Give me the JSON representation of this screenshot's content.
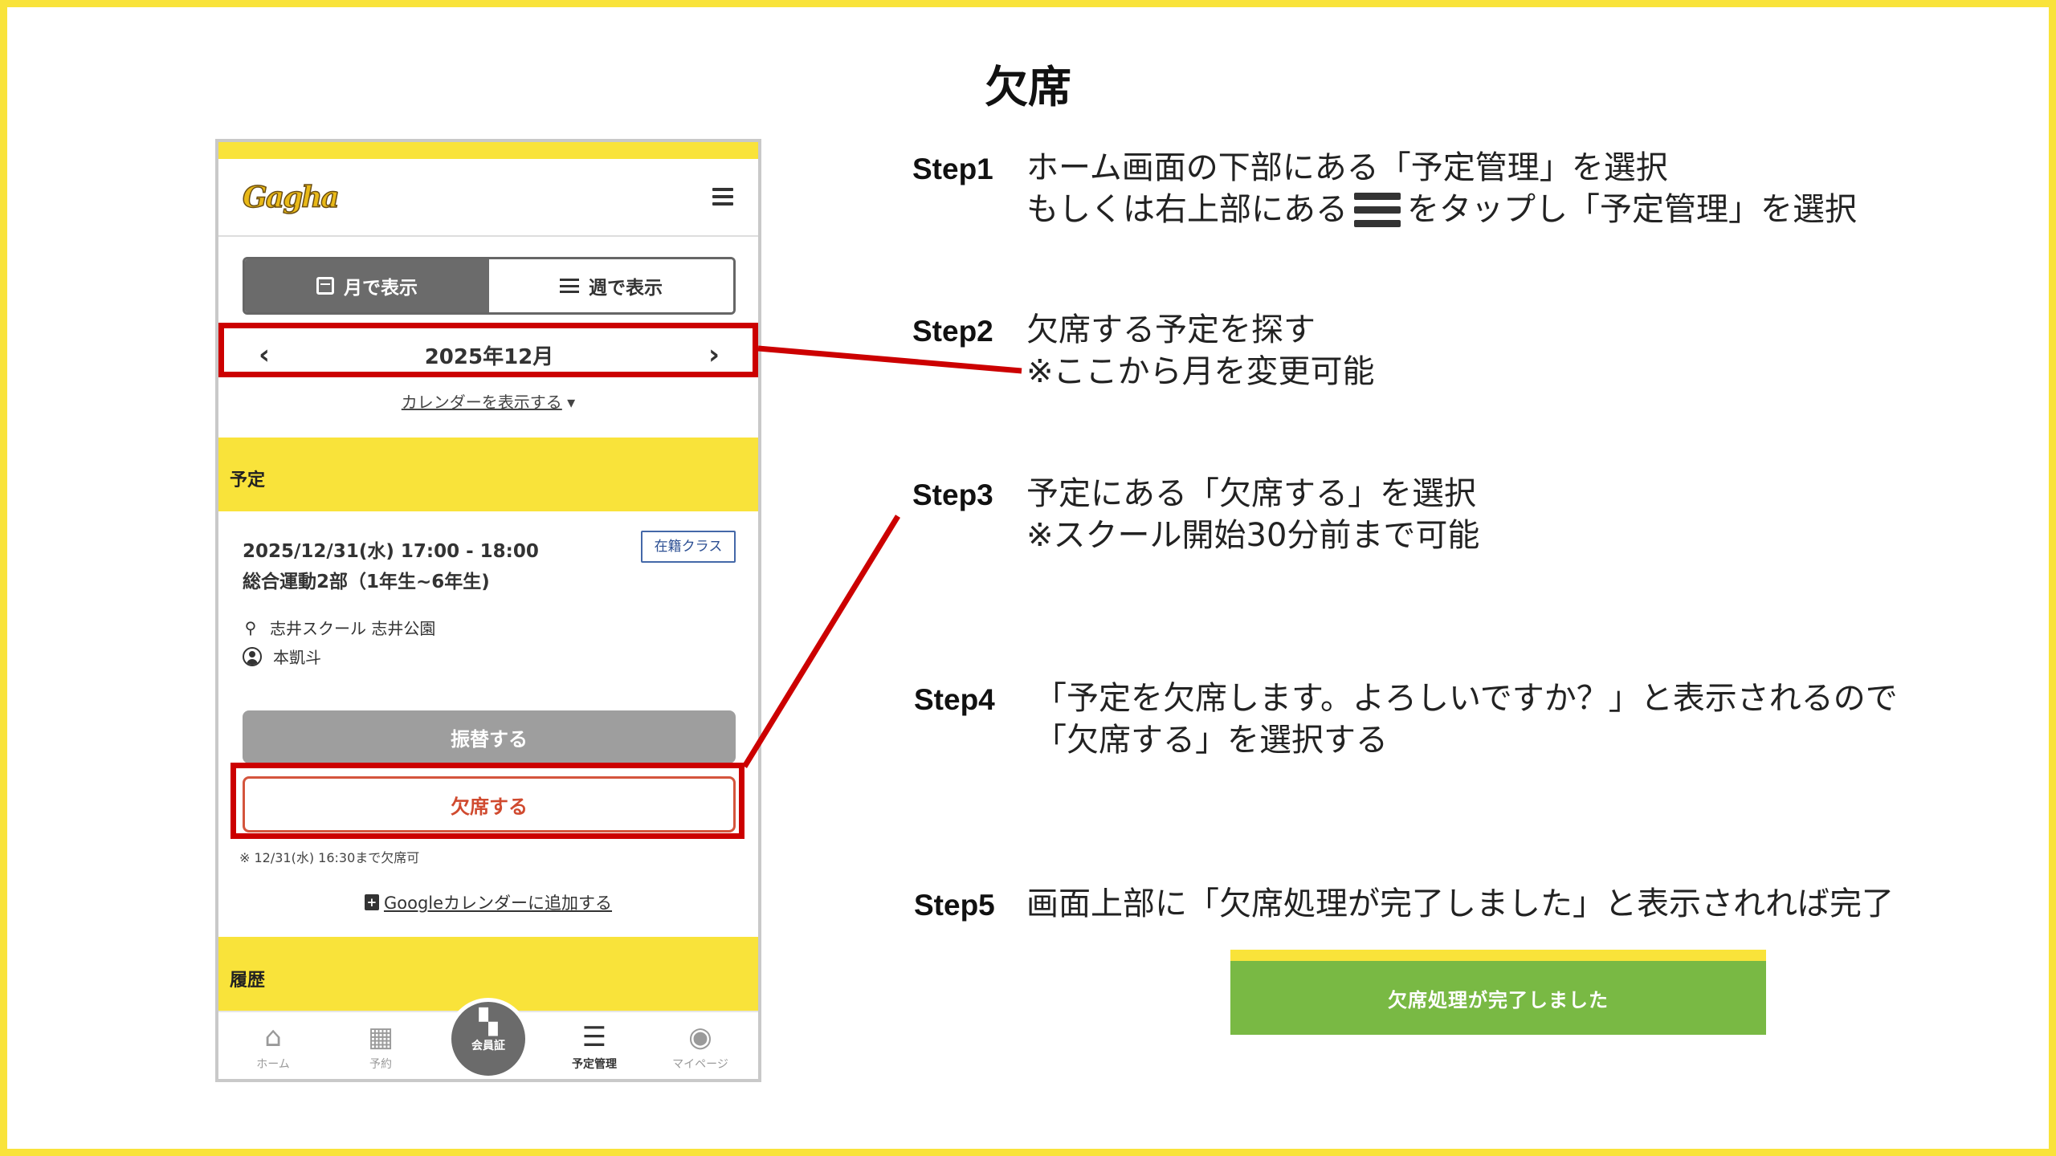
{
  "slide": {
    "title": "欠席"
  },
  "app": {
    "logo_text": "Gagha",
    "view_toggle": {
      "month_label": "月で表示",
      "week_label": "週で表示"
    },
    "month_nav": {
      "prev": "‹",
      "current": "2025年12月",
      "next": "›"
    },
    "show_calendar": "カレンダーを表示する",
    "show_calendar_caret": "▾",
    "schedule_section": "予定",
    "event": {
      "datetime": "2025/12/31(水) 17:00 - 18:00",
      "name": "総合運動2部（1年生~6年生)",
      "badge": "在籍クラス",
      "location": "志井スクール  志井公園",
      "coach": "本凱斗",
      "transfer_button": "振替する",
      "absent_button": "欠席する",
      "deadline_note": "※ 12/31(水) 16:30まで欠席可",
      "google_calendar_link": "Googleカレンダーに追加する"
    },
    "history_section": "履歴",
    "bottom_nav": {
      "home": "ホーム",
      "reserve": "予約",
      "member_card": "会員証",
      "schedule_mgmt": "予定管理",
      "mypage": "マイページ"
    }
  },
  "steps": [
    {
      "label": "Step1",
      "line1": "ホーム画面の下部にある「予定管理」を選択",
      "line2_before": "もしくは右上部にある",
      "line2_after": "をタップし「予定管理」を選択"
    },
    {
      "label": "Step2",
      "line1": "欠席する予定を探す",
      "line2": "※ここから月を変更可能"
    },
    {
      "label": "Step3",
      "line1": "予定にある「欠席する」を選択",
      "line2": "※スクール開始30分前まで可能"
    },
    {
      "label": "Step4",
      "line1": "「予定を欠席します。よろしいですか？」と表示されるので",
      "line2": "「欠席する」を選択する"
    },
    {
      "label": "Step5",
      "line1": "画面上部に「欠席処理が完了しました」と表示されれば完了"
    }
  ],
  "toast": {
    "message": "欠席処理が完了しました"
  },
  "colors": {
    "brand_yellow": "#f9e33a",
    "highlight_red": "#cc0000",
    "success_green": "#79b944",
    "absent_red": "#d04a2f"
  }
}
